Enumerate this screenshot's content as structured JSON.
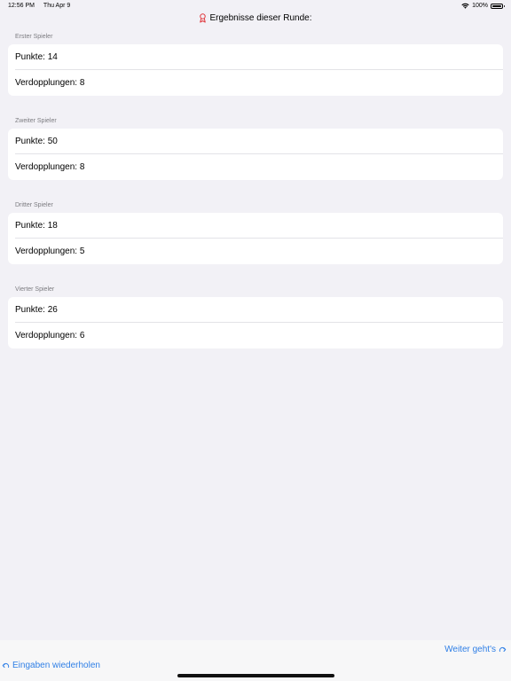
{
  "status_bar": {
    "time": "12:56 PM",
    "date": "Thu Apr 9",
    "battery": "100%",
    "icons": [
      "wifi-icon",
      "battery-icon"
    ]
  },
  "navigation": {
    "title": "Ergebnisse dieser Runde:",
    "icon": "ribbon-award-icon"
  },
  "sections": [
    {
      "header": "Erster Spieler",
      "points": "Punkte: 14",
      "doublings": "Verdopplungen: 8"
    },
    {
      "header": "Zweiter Spieler",
      "points": "Punkte: 50",
      "doublings": "Verdopplungen: 8"
    },
    {
      "header": "Dritter Spieler",
      "points": "Punkte: 18",
      "doublings": "Verdopplungen: 5"
    },
    {
      "header": "Vierter Spieler",
      "points": "Punkte: 26",
      "doublings": "Verdopplungen: 6"
    }
  ],
  "toolbar": {
    "next_label": "Weiter geht's",
    "repeat_label": "Eingaben wiederholen",
    "accent_color": "#2f7fe6"
  },
  "colors": {
    "background": "#f2f1f6",
    "card": "#ffffff",
    "section_header": "#7c7c80",
    "award_icon": "#e0393e"
  }
}
